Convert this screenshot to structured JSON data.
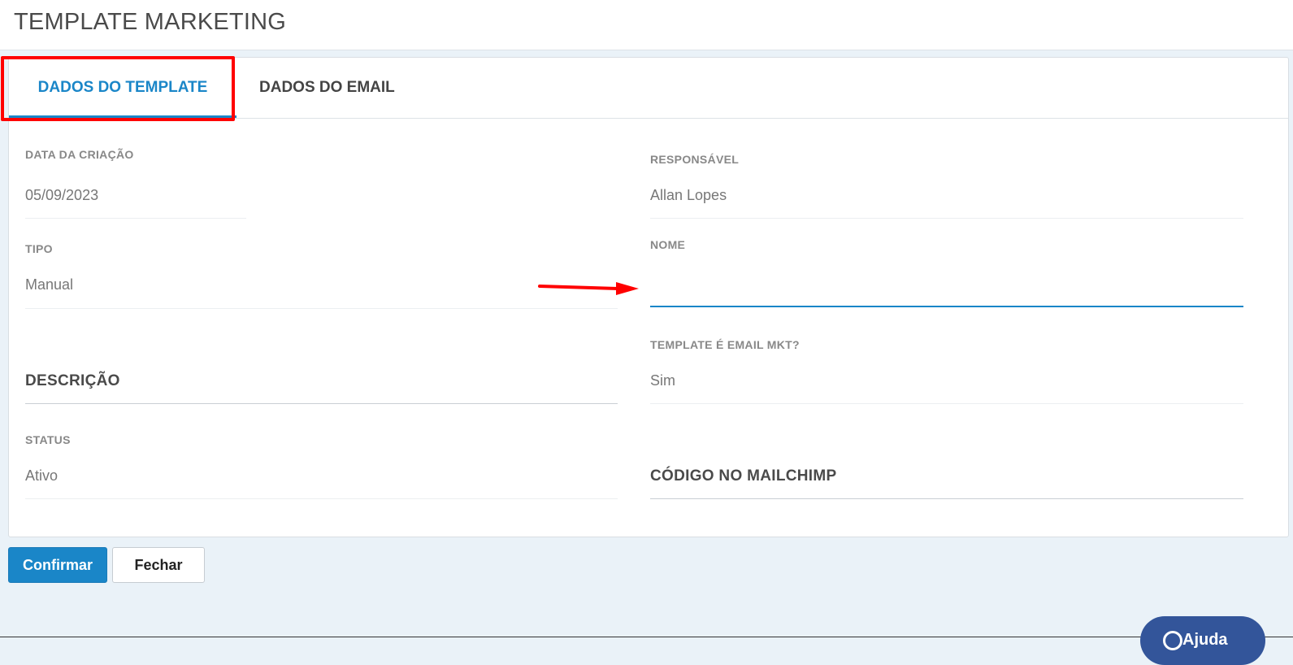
{
  "page": {
    "title": "TEMPLATE MARKETING"
  },
  "tabs": [
    {
      "label": "DADOS DO TEMPLATE",
      "active": true
    },
    {
      "label": "DADOS DO EMAIL",
      "active": false
    }
  ],
  "fields": {
    "data_criacao": {
      "label": "DATA DA CRIAÇÃO",
      "value": "05/09/2023"
    },
    "responsavel": {
      "label": "RESPONSÁVEL",
      "value": "Allan Lopes"
    },
    "tipo": {
      "label": "TIPO",
      "value": "Manual"
    },
    "nome": {
      "label": "NOME",
      "value": ""
    },
    "email_mkt": {
      "label": "TEMPLATE É EMAIL MKT?",
      "value": "Sim"
    },
    "status": {
      "label": "STATUS",
      "value": "Ativo"
    }
  },
  "sections": {
    "descricao": "DESCRIÇÃO",
    "codigo_mailchimp": "CÓDIGO NO MAILCHIMP"
  },
  "buttons": {
    "confirm": "Confirmar",
    "close": "Fechar"
  },
  "help": {
    "label": "Ajuda"
  },
  "colors": {
    "accent": "#1a86c8",
    "highlight": "#ff0000",
    "help_bg": "#33559a"
  }
}
